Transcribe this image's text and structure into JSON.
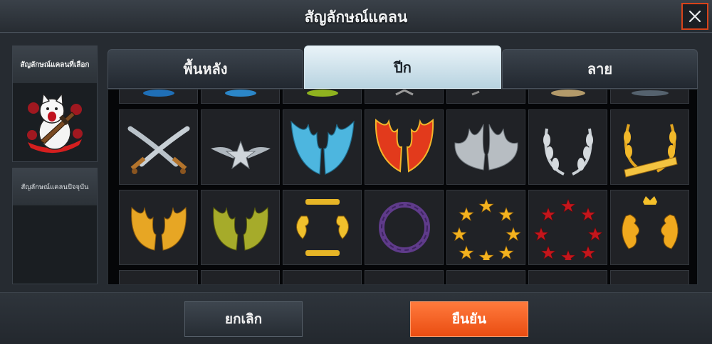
{
  "dialog": {
    "title": "สัญลักษณ์แคลน",
    "close_icon": "close-x-icon"
  },
  "sidebar": {
    "selected_label": "สัญลักษณ์แคลนที่เลือก",
    "current_label": "สัญลักษณ์แคลนปัจจุบัน",
    "selected_emblem": "cat-with-rifle-and-roses-emblem"
  },
  "tabs": [
    {
      "label": "พื้นหลัง",
      "active": false
    },
    {
      "label": "ปีก",
      "active": true
    },
    {
      "label": "ลาย",
      "active": false
    }
  ],
  "grid": {
    "rows": [
      [
        "crossed-swords",
        "silver-star-wings",
        "blue-angel-wings",
        "red-phoenix-wings",
        "silver-feather-wings",
        "silver-laurel-wreath",
        "gold-laurel-banner"
      ],
      [
        "gold-wings",
        "olive-green-wings",
        "gold-dragon-frame",
        "purple-thorn-ring",
        "gold-star-ring",
        "red-star-ring",
        "gold-flame-crown"
      ]
    ]
  },
  "colors": {
    "confirm": "#f05a1e",
    "close_border": "#d8431a",
    "active_tab": "#d6e8f1"
  },
  "footer": {
    "cancel_label": "ยกเลิก",
    "confirm_label": "ยืนยัน"
  }
}
